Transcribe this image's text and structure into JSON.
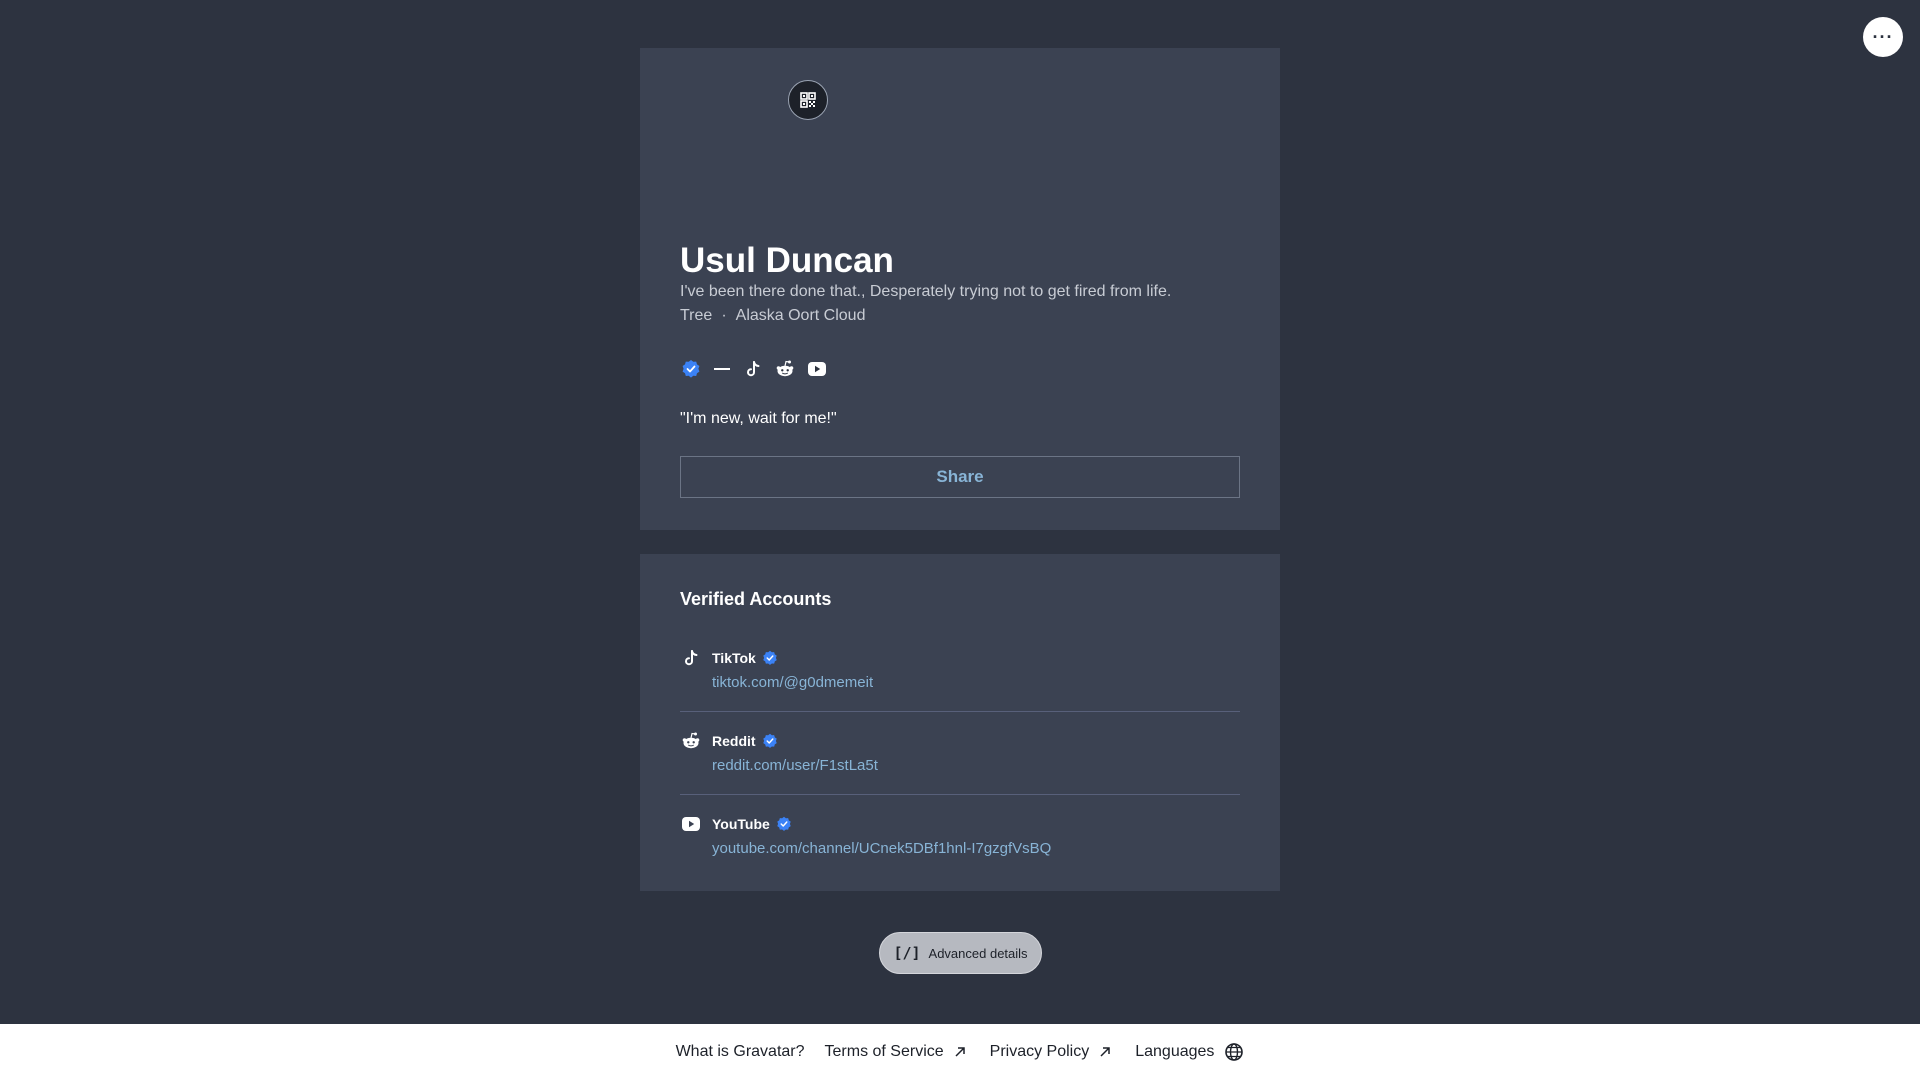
{
  "header": {
    "more_icon": "ellipsis-icon",
    "more_label": "···"
  },
  "profile": {
    "qr_icon": "qr-code-icon",
    "display_name": "Usul Duncan",
    "tagline": "I've been there done that., Desperately trying not to get fired from life.",
    "meta": {
      "job": "Tree",
      "separator": "·",
      "location": "Alaska Oort Cloud"
    },
    "icons": [
      "verified-badge-icon",
      "dash-icon",
      "tiktok-icon",
      "reddit-icon",
      "youtube-icon"
    ],
    "about": "\"I'm new, wait for me!\"",
    "share_label": "Share"
  },
  "verified_accounts": {
    "title": "Verified Accounts",
    "items": [
      {
        "service": "TikTok",
        "url": "tiktok.com/@g0dmemeit",
        "icon": "tiktok-icon"
      },
      {
        "service": "Reddit",
        "url": "reddit.com/user/F1stLa5t",
        "icon": "reddit-icon"
      },
      {
        "service": "YouTube",
        "url": "youtube.com/channel/UCnek5DBf1hnl-I7gzgfVsBQ",
        "icon": "youtube-icon"
      }
    ]
  },
  "advanced": {
    "glyph": "[/]",
    "label": "Advanced details"
  },
  "footer": {
    "what_is": "What is Gravatar?",
    "terms": "Terms of Service",
    "privacy": "Privacy Policy",
    "languages": "Languages"
  },
  "colors": {
    "background": "#2d3340",
    "card": "#3b4252",
    "link": "#88b4d6",
    "verified": "#3b82f6"
  }
}
